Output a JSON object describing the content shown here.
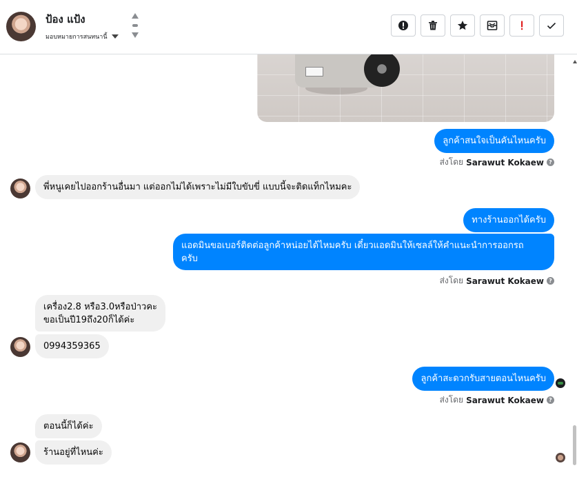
{
  "header": {
    "contact_name": "ป้อง แป้ง",
    "assign_label": "มอบหมายการสนทนานี้",
    "toolbar": [
      "mark-spam-icon",
      "delete-icon",
      "star-icon",
      "mark-unread-icon",
      "flag-important-icon",
      "done-check-icon"
    ]
  },
  "colors": {
    "outgoing": "#0084ff",
    "incoming": "#f0f0f0",
    "flag": "#e02020"
  },
  "messages": {
    "m1": "ลูกค้าสนใจเป็นคันไหนครับ",
    "m2": "พี่หนูเคยไปออกร้านอื่นมา แต่ออกไม่ได้เพราะไม่มีใบขับขี่  แบบนี้จะติดแท็กไหมคะ",
    "m3": "ทางร้านออกได้ครับ",
    "m4a": "แอดมินขอเบอร์ติดต่อลูกค้าหน่อยได้ไหมครับ เดี๋ยวแอดมินให้เซลล์ให้คำแนะนำการออกรถ",
    "m4b": "ครับ",
    "m5a": "เครื่อง2.8 หรือ3.0หรือป่าวคะ",
    "m5b": "ขอเป็นปี19ถึง20ก็ได้ค่ะ",
    "m6": "0994359365",
    "m7": "ลูกค้าสะดวกรับสายตอนไหนครับ",
    "m8": "ตอนนี้ก็ได้ค่ะ",
    "m9": "ร้านอยู่ที่ไหนค่ะ"
  },
  "sent_by": {
    "prefix": "ส่งโดย",
    "agent": "Sarawut Kokaew"
  }
}
